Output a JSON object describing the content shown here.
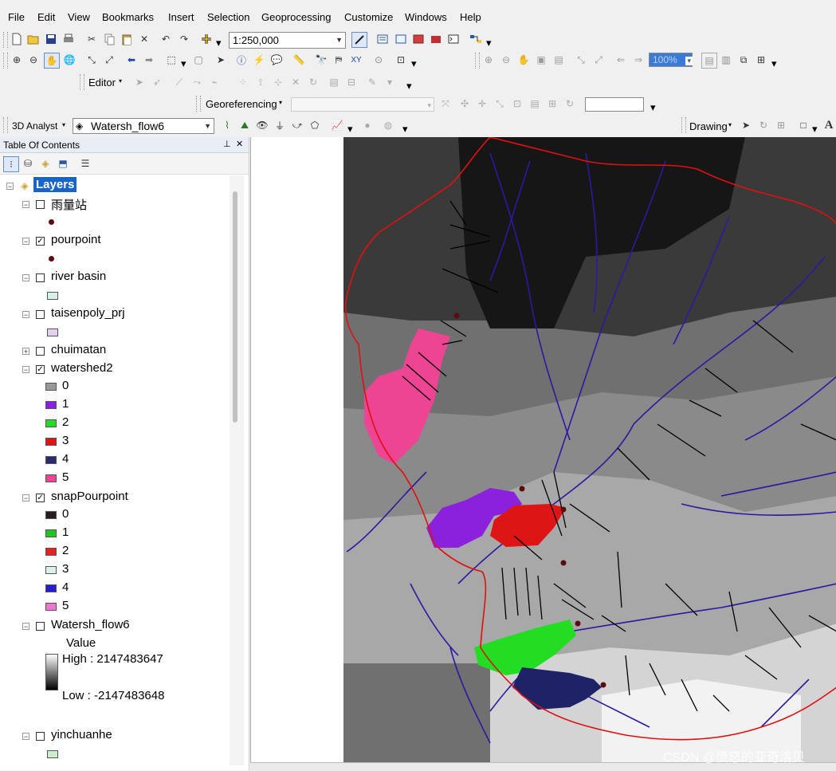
{
  "menu": [
    "File",
    "Edit",
    "View",
    "Bookmarks",
    "Insert",
    "Selection",
    "Geoprocessing",
    "Customize",
    "Windows",
    "Help"
  ],
  "toolbar": {
    "scale_value": "1:250,000",
    "zoom_percent": "100%",
    "editor_label": "Editor",
    "georef_label": "Georeferencing",
    "analyst_label": "3D Analyst",
    "layer_combo": "Watersh_flow6",
    "drawing_label": "Drawing"
  },
  "toc": {
    "title": "Table Of Contents",
    "root": "Layers",
    "layers": [
      {
        "name": "雨量站",
        "checked": false,
        "type": "point",
        "color": "#5b0b10"
      },
      {
        "name": "pourpoint",
        "checked": true,
        "type": "point",
        "color": "#5b0b10"
      },
      {
        "name": "river basin",
        "checked": false,
        "type": "poly",
        "color": "#d6f2e8"
      },
      {
        "name": "taisenpoly_prj",
        "checked": false,
        "type": "poly",
        "color": "#e6d0f0"
      },
      {
        "name": "chuimatan",
        "checked": false,
        "type": "collapsed"
      },
      {
        "name": "watershed2",
        "checked": true,
        "type": "classes",
        "classes": [
          {
            "label": "0",
            "color": "#999999"
          },
          {
            "label": "1",
            "color": "#8a22dd"
          },
          {
            "label": "2",
            "color": "#22dd22"
          },
          {
            "label": "3",
            "color": "#dd1515"
          },
          {
            "label": "4",
            "color": "#2a2a6e"
          },
          {
            "label": "5",
            "color": "#ee4494"
          }
        ]
      },
      {
        "name": "snapPourpoint",
        "checked": true,
        "type": "classes",
        "classes": [
          {
            "label": "0",
            "color": "#2a1a22"
          },
          {
            "label": "1",
            "color": "#22c422"
          },
          {
            "label": "2",
            "color": "#e52222"
          },
          {
            "label": "3",
            "color": "#d8f2e8"
          },
          {
            "label": "4",
            "color": "#2222cc"
          },
          {
            "label": "5",
            "color": "#ee77cc"
          }
        ]
      },
      {
        "name": "Watersh_flow6",
        "checked": false,
        "type": "stretch",
        "value_label": "Value",
        "high": "High : 2147483647",
        "low": "Low : -2147483648"
      },
      {
        "name": "yinchuanhe",
        "checked": false,
        "type": "poly",
        "color": "#cdeecd"
      }
    ]
  },
  "watermark": "CSDN @愤怒的亚奇洛贝",
  "colors": {
    "boundary": "#e01010",
    "streams": "#2a1aa0",
    "faults": "#000000"
  }
}
